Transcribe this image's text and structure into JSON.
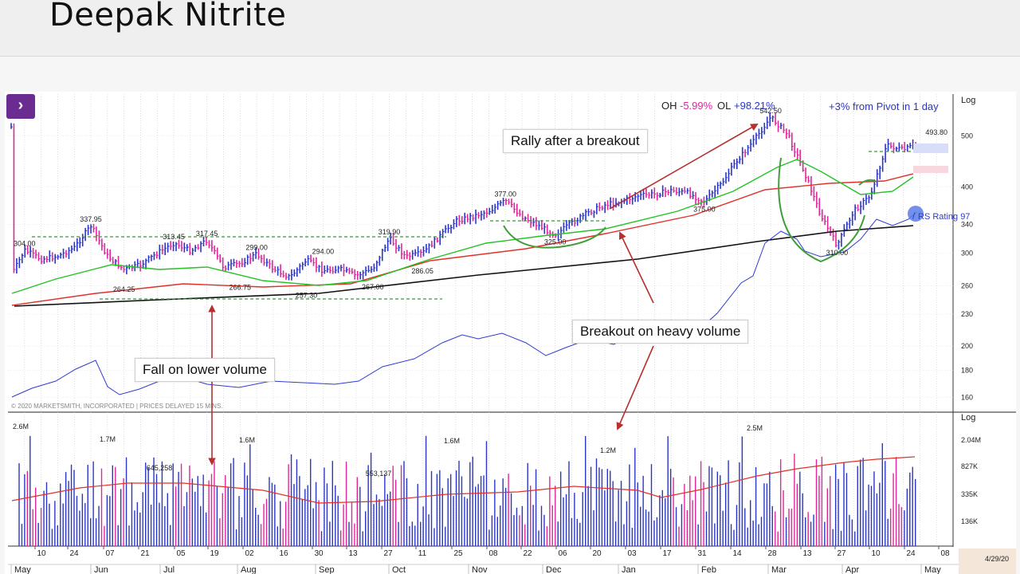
{
  "page": {
    "title": "Deepak Nitrite",
    "nav_icon": "chevron-right-icon"
  },
  "header_stats": {
    "oh_label": "OH",
    "oh_value": "-5.99%",
    "ol_label": "OL",
    "ol_value": "+98.21%",
    "pivot_text": "+3% from Pivot in 1 day"
  },
  "annotations": {
    "rally": "Rally after a breakout",
    "breakout": "Breakout on heavy volume",
    "fall": "Fall on lower volume",
    "copyright": "© 2020 MARKETSMITH, INCORPORATED | PRICES DELAYED 15 MINS.",
    "rs_rating": "RS Rating 97",
    "date_stamp": "4/29/20"
  },
  "colors": {
    "up": "#2b36c9",
    "down": "#e0279a",
    "ma_short": "#22c322",
    "ma_mid": "#e0302a",
    "ma_long": "#111111",
    "rs_line": "#2f3ad2",
    "accent": "#6a2c91",
    "arrow": "#b5302f",
    "pattern": "#3f9e3a"
  },
  "chart_data": [
    {
      "type": "line",
      "name": "price",
      "scale": "log",
      "scale_label": "Log",
      "y_ticks": [
        160,
        180,
        200,
        230,
        260,
        300,
        340,
        400,
        500
      ],
      "x_ticks": [
        "10",
        "24",
        "07",
        "21",
        "05",
        "19",
        "02",
        "16",
        "30",
        "13",
        "27",
        "11",
        "25",
        "08",
        "22",
        "06",
        "20",
        "03",
        "17",
        "31",
        "14",
        "28",
        "13",
        "27",
        "10",
        "24",
        "08"
      ],
      "month_labels": [
        "May",
        "Jun",
        "Jul",
        "Aug",
        "Sep",
        "Oct",
        "Nov",
        "Dec",
        "Jan",
        "Feb",
        "Mar",
        "Apr",
        "May"
      ],
      "price_path": [
        [
          "2019-05-01",
          275
        ],
        [
          "2019-05-06",
          304
        ],
        [
          "2019-05-13",
          292
        ],
        [
          "2019-05-20",
          296
        ],
        [
          "2019-05-27",
          307
        ],
        [
          "2019-06-03",
          337.95
        ],
        [
          "2019-06-10",
          296
        ],
        [
          "2019-06-17",
          279
        ],
        [
          "2019-06-24",
          285
        ],
        [
          "2019-07-01",
          300
        ],
        [
          "2019-07-08",
          313.45
        ],
        [
          "2019-07-15",
          303
        ],
        [
          "2019-07-22",
          317.45
        ],
        [
          "2019-07-29",
          282
        ],
        [
          "2019-08-05",
          287
        ],
        [
          "2019-08-12",
          299
        ],
        [
          "2019-08-19",
          280
        ],
        [
          "2019-08-26",
          270
        ],
        [
          "2019-09-02",
          291
        ],
        [
          "2019-09-09",
          278
        ],
        [
          "2019-09-16",
          280
        ],
        [
          "2019-09-23",
          272
        ],
        [
          "2019-09-30",
          280
        ],
        [
          "2019-10-07",
          319.9
        ],
        [
          "2019-10-14",
          295
        ],
        [
          "2019-10-21",
          300
        ],
        [
          "2019-10-28",
          322
        ],
        [
          "2019-11-04",
          345
        ],
        [
          "2019-11-11",
          352
        ],
        [
          "2019-11-18",
          360
        ],
        [
          "2019-11-25",
          377
        ],
        [
          "2019-12-02",
          352
        ],
        [
          "2019-12-09",
          338
        ],
        [
          "2019-12-16",
          325
        ],
        [
          "2019-12-23",
          342
        ],
        [
          "2019-12-30",
          358
        ],
        [
          "2020-01-06",
          370
        ],
        [
          "2020-01-13",
          376
        ],
        [
          "2020-01-20",
          385
        ],
        [
          "2020-01-27",
          388
        ],
        [
          "2020-02-03",
          394
        ],
        [
          "2020-02-10",
          390
        ],
        [
          "2020-02-17",
          375
        ],
        [
          "2020-02-24",
          405
        ],
        [
          "2020-03-02",
          450
        ],
        [
          "2020-03-09",
          490
        ],
        [
          "2020-03-16",
          542.5
        ],
        [
          "2020-03-23",
          505
        ],
        [
          "2020-03-30",
          430
        ],
        [
          "2020-04-06",
          355
        ],
        [
          "2020-04-13",
          310
        ],
        [
          "2020-04-20",
          360
        ],
        [
          "2020-04-27",
          385
        ],
        [
          "2020-05-04",
          480
        ],
        [
          "2020-05-11",
          470
        ],
        [
          "2020-05-18",
          485
        ],
        [
          "2020-05-25",
          493.8
        ],
        [
          "2020-05-29",
          520
        ]
      ],
      "price_labels": [
        {
          "x": "2019-05-06",
          "value": 304.0,
          "text": "304.00"
        },
        {
          "x": "2019-06-03",
          "value": 337.95,
          "text": "337.95"
        },
        {
          "x": "2019-06-17",
          "value": 264.25,
          "text": "264.25"
        },
        {
          "x": "2019-07-08",
          "value": 313.45,
          "text": "313.45"
        },
        {
          "x": "2019-07-22",
          "value": 317.45,
          "text": "317.45"
        },
        {
          "x": "2019-08-05",
          "value": 266.75,
          "text": "266.75"
        },
        {
          "x": "2019-08-12",
          "value": 299.0,
          "text": "299.00"
        },
        {
          "x": "2019-09-02",
          "value": 257.3,
          "text": "257.30"
        },
        {
          "x": "2019-09-09",
          "value": 294.0,
          "text": "294.00"
        },
        {
          "x": "2019-09-30",
          "value": 267.0,
          "text": "267.00"
        },
        {
          "x": "2019-10-07",
          "value": 319.9,
          "text": "319.90"
        },
        {
          "x": "2019-10-21",
          "value": 286.05,
          "text": "286.05"
        },
        {
          "x": "2019-11-25",
          "value": 377.0,
          "text": "377.00"
        },
        {
          "x": "2019-12-16",
          "value": 325.0,
          "text": "325.00"
        },
        {
          "x": "2020-02-17",
          "value": 375.0,
          "text": "375.00"
        },
        {
          "x": "2020-03-16",
          "value": 542.5,
          "text": "542.50"
        },
        {
          "x": "2020-04-13",
          "value": 310.0,
          "text": "310.00"
        },
        {
          "x": "2020-05-25",
          "value": 493.8,
          "text": "493.80"
        }
      ]
    },
    {
      "type": "bar",
      "name": "volume",
      "scale": "log",
      "scale_label": "Log",
      "y_ticks": [
        "2.04M",
        "827K",
        "335K",
        "136K"
      ],
      "volume_labels": [
        {
          "x": "2019-05-01",
          "text": "2.6M"
        },
        {
          "x": "2019-06-03",
          "text": "1.7M"
        },
        {
          "x": "2019-07-01",
          "text": "645,258"
        },
        {
          "x": "2019-08-05",
          "text": "1.6M"
        },
        {
          "x": "2019-10-07",
          "text": "553,137"
        },
        {
          "x": "2019-11-11",
          "text": "1.6M"
        },
        {
          "x": "2020-01-20",
          "text": "1.2M"
        },
        {
          "x": "2020-03-02",
          "text": "2.5M"
        }
      ]
    }
  ]
}
